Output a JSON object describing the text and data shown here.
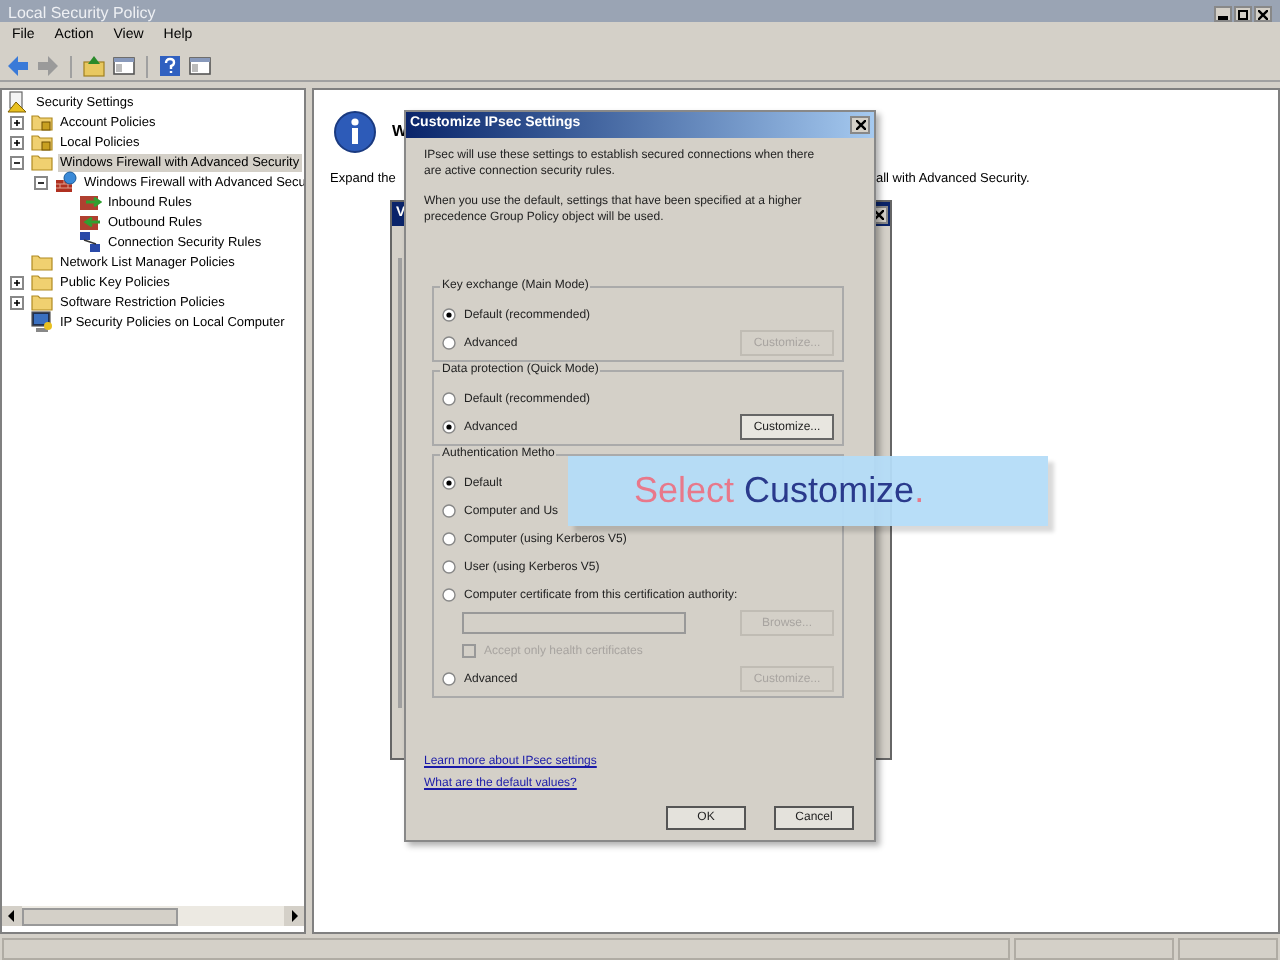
{
  "window": {
    "title": "Local Security Policy"
  },
  "menu": [
    "File",
    "Action",
    "View",
    "Help"
  ],
  "toolbar": [
    {
      "kind": "back",
      "disabled": false
    },
    {
      "kind": "forward",
      "disabled": true
    },
    {
      "kind": "up"
    },
    {
      "kind": "pane"
    },
    {
      "kind": "help"
    },
    {
      "kind": "pane"
    }
  ],
  "tree": [
    {
      "label": "Security Settings",
      "kind": "root",
      "selected": false,
      "children": [
        {
          "label": "Account Policies",
          "kind": "locked-folder",
          "selected": false,
          "expanded": false
        },
        {
          "label": "Local Policies",
          "kind": "locked-folder",
          "selected": false,
          "expanded": false
        },
        {
          "label": "Windows Firewall with Advanced Security",
          "kind": "folder",
          "selected": true,
          "expanded": true,
          "children": [
            {
              "label": "Windows Firewall with Advanced Secu",
              "kind": "firewall",
              "selected": false,
              "expanded": true,
              "children": [
                {
                  "label": "Inbound Rules",
                  "kind": "inbound",
                  "selected": false
                },
                {
                  "label": "Outbound Rules",
                  "kind": "outbound",
                  "selected": false
                },
                {
                  "label": "Connection Security Rules",
                  "kind": "connection",
                  "selected": false
                }
              ]
            }
          ]
        },
        {
          "label": "Network List Manager Policies",
          "kind": "folder",
          "selected": false
        },
        {
          "label": "Public Key Policies",
          "kind": "folder",
          "selected": false,
          "expanded": false
        },
        {
          "label": "Software Restriction Policies",
          "kind": "folder",
          "selected": false,
          "expanded": false
        },
        {
          "label": "IP Security Policies on Local Computer",
          "kind": "computer",
          "selected": false
        }
      ]
    }
  ],
  "details": {
    "heading": "W",
    "text_left": "Expand the",
    "text_right": "all with Advanced Security."
  },
  "back_dialog": {
    "title": "V"
  },
  "dialog": {
    "title": "Customize IPsec Settings",
    "intro": "IPsec will use these settings to establish secured connections when there are active connection security rules.",
    "note": "When you use the default, settings that have been specified at a higher precedence Group Policy object will be used.",
    "groups": [
      {
        "title": "Key exchange (Main Mode)",
        "options": [
          {
            "kind": "radio",
            "label": "Default (recommended)",
            "selected": true
          },
          {
            "kind": "radio",
            "label": "Advanced",
            "selected": false,
            "button": {
              "label": "Customize...",
              "disabled": true
            }
          }
        ]
      },
      {
        "title": "Data protection (Quick Mode)",
        "options": [
          {
            "kind": "radio",
            "label": "Default (recommended)",
            "selected": false
          },
          {
            "kind": "radio",
            "label": "Advanced",
            "selected": true,
            "button": {
              "label": "Customize...",
              "disabled": false
            }
          }
        ]
      },
      {
        "title": "Authentication Metho",
        "options": [
          {
            "kind": "radio",
            "label": "Default",
            "selected": true
          },
          {
            "kind": "radio",
            "label": "Computer and Us",
            "selected": false
          },
          {
            "kind": "radio",
            "label": "Computer (using Kerberos V5)",
            "selected": false
          },
          {
            "kind": "radio",
            "label": "User (using Kerberos V5)",
            "selected": false
          },
          {
            "kind": "radio",
            "label": "Computer certificate from this certification authority:",
            "selected": false
          },
          {
            "kind": "field",
            "disabled": true,
            "button": {
              "label": "Browse...",
              "disabled": true
            }
          },
          {
            "kind": "checkbox",
            "label": "Accept only health certificates",
            "checked": false,
            "disabled": true
          },
          {
            "kind": "radio",
            "label": "Advanced",
            "selected": false,
            "button": {
              "label": "Customize...",
              "disabled": true
            }
          }
        ]
      }
    ],
    "links": [
      "Learn more about IPsec settings",
      "What are the default values?"
    ],
    "buttons": [
      "OK",
      "Cancel"
    ]
  },
  "callout": {
    "parts": [
      {
        "text": "Select",
        "color": "#e8788a"
      },
      {
        "text": "Customize",
        "color": "#2a3a8c"
      },
      {
        "text": ".",
        "color": "#e8788a"
      }
    ]
  }
}
